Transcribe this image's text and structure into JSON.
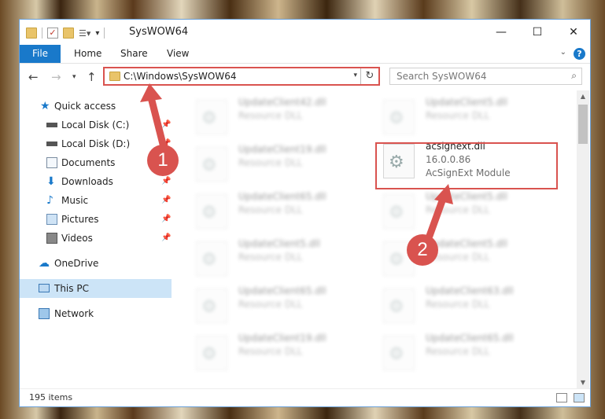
{
  "window": {
    "title": "SysWOW64",
    "minimize": "—",
    "maximize": "☐",
    "close": "✕"
  },
  "ribbon": {
    "file_tab": "File",
    "tabs": [
      "Home",
      "Share",
      "View"
    ],
    "help": "?"
  },
  "address_bar": {
    "path": "C:\\Windows\\SysWOW64",
    "refresh": "↻"
  },
  "search": {
    "placeholder": "Search SysWOW64"
  },
  "navigation": {
    "quick_access": "Quick access",
    "quick_items": [
      "Local Disk (C:)",
      "Local Disk (D:)",
      "Documents",
      "Downloads",
      "Music",
      "Pictures",
      "Videos"
    ],
    "onedrive": "OneDrive",
    "this_pc": "This PC",
    "network": "Network"
  },
  "files": {
    "left_column": [
      {
        "name": "UpdateClient42.dll",
        "desc": "Resource DLL"
      },
      {
        "name": "UpdateClient19.dll",
        "desc": "Resource DLL"
      },
      {
        "name": "UpdateClient65.dll",
        "desc": "Resource DLL"
      },
      {
        "name": "UpdateClient5.dll",
        "desc": "Resource DLL"
      },
      {
        "name": "UpdateClient65.dll",
        "desc": "Resource DLL"
      },
      {
        "name": "UpdateClient19.dll",
        "desc": "Resource DLL"
      }
    ],
    "right_column": [
      {
        "name": "UpdateClient5.dll",
        "desc": "Resource DLL"
      },
      {
        "name": "UpdateClient5.dll",
        "desc": "Resource DLL"
      },
      {
        "name": "UpdateClient5.dll",
        "desc": "Resource DLL"
      },
      {
        "name": "UpdateClient63.dll",
        "desc": "Resource DLL"
      },
      {
        "name": "UpdateClient65.dll",
        "desc": "Resource DLL"
      }
    ],
    "highlighted": {
      "name": "acsignext.dll",
      "version": "16.0.0.86",
      "desc": "AcSignExt Module"
    }
  },
  "status": {
    "item_count": "195 items"
  },
  "annotations": {
    "step1": "1",
    "step2": "2",
    "color": "#d9534f"
  }
}
